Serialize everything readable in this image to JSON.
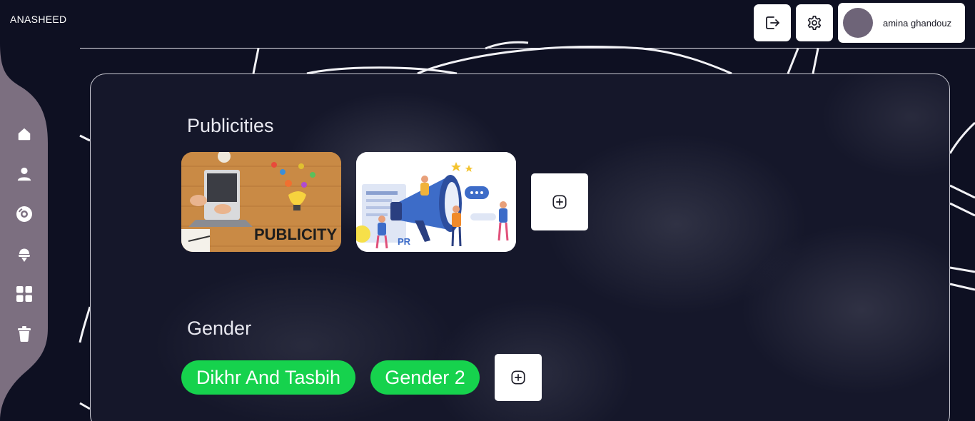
{
  "app": {
    "brand": "ANASHEED"
  },
  "header": {
    "user_name": "amina ghandouz"
  },
  "sidebar": {
    "icons": [
      "home-icon",
      "user-icon",
      "disc-icon",
      "microphone-icon",
      "grid-icon",
      "trash-icon"
    ]
  },
  "main": {
    "publicities": {
      "title": "Publicities",
      "cards": [
        {
          "label": "PUBLICITY"
        },
        {
          "label": "PR"
        }
      ]
    },
    "gender": {
      "title": "Gender",
      "chips": [
        "Dikhr And Tasbih",
        "Gender 2"
      ]
    }
  },
  "colors": {
    "background": "#0e1022",
    "sidebar": "#7c6f80",
    "chip": "#16d24d",
    "white": "#ffffff"
  }
}
